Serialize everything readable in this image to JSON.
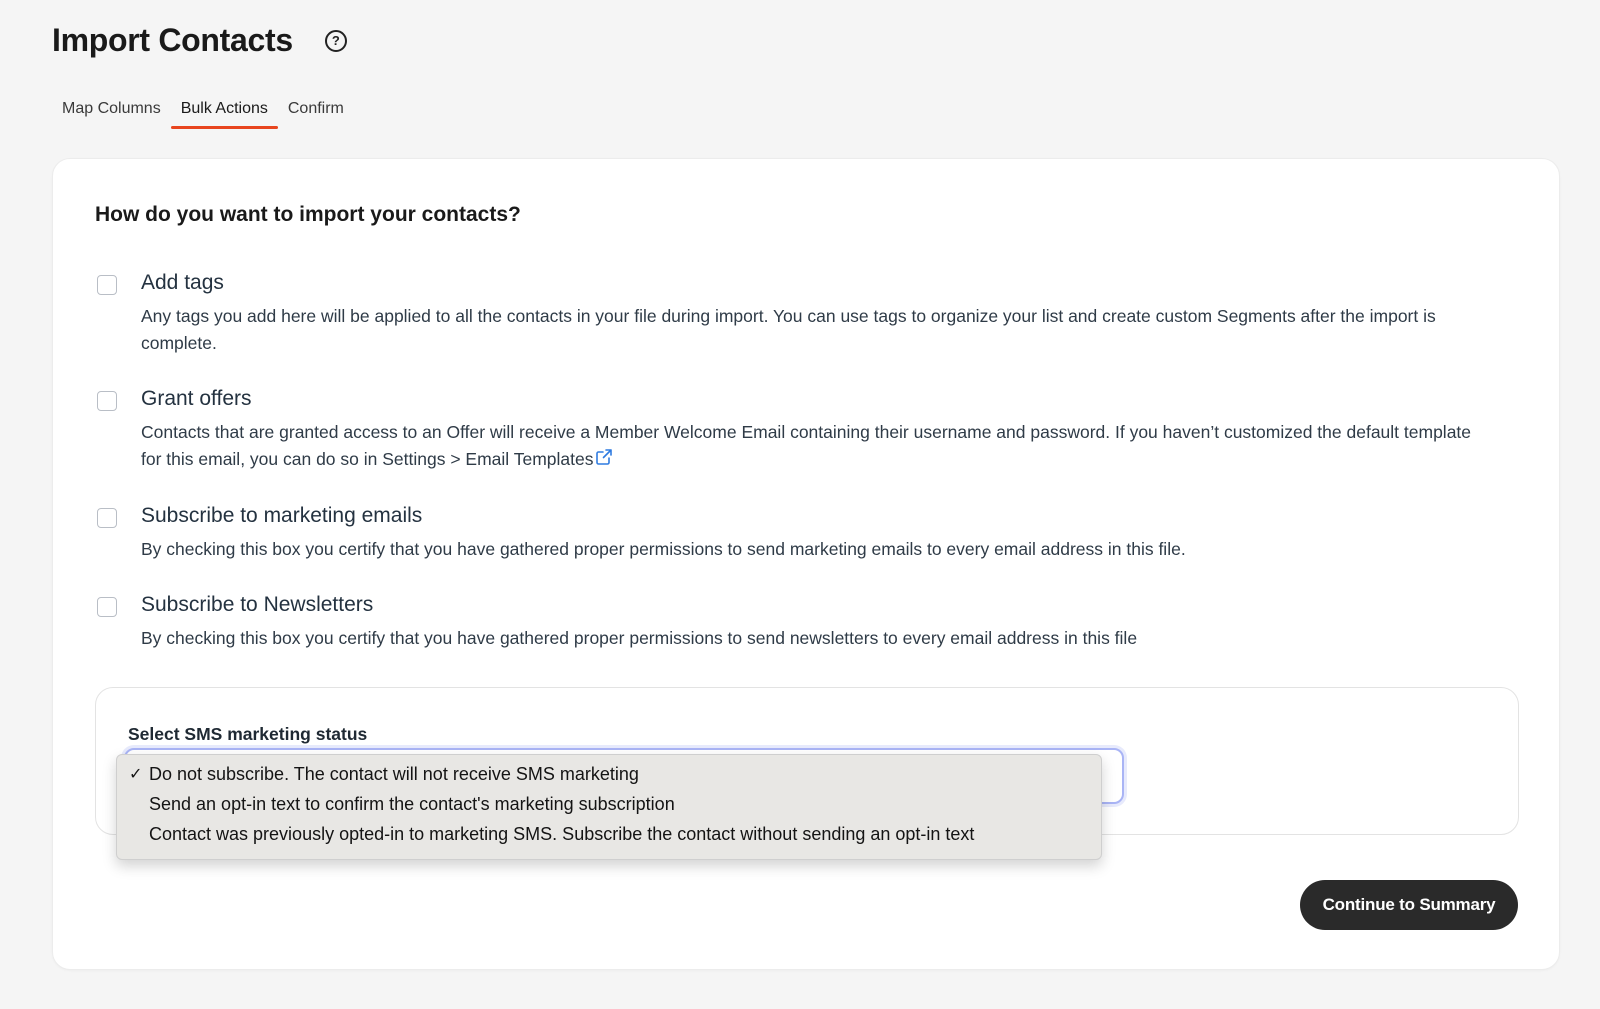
{
  "header": {
    "title": "Import Contacts",
    "help_icon": "question-circle-icon"
  },
  "tabs": [
    {
      "label": "Map Columns",
      "active": false
    },
    {
      "label": "Bulk Actions",
      "active": true
    },
    {
      "label": "Confirm",
      "active": false
    }
  ],
  "card": {
    "heading": "How do you want to import your contacts?",
    "options": [
      {
        "title": "Add tags",
        "description": "Any tags you add here will be applied to all the contacts in your file during import. You can use tags to organize your list and create custom Segments after the import is complete.",
        "checked": false
      },
      {
        "title": "Grant offers",
        "description": "Contacts that are granted access to an Offer will receive a Member Welcome Email containing their username and password. If you haven’t customized the default template for this email, you can do so in Settings > Email Templates",
        "checked": false,
        "link_icon": "external-link-icon"
      },
      {
        "title": "Subscribe to marketing emails",
        "description": "By checking this box you certify that you have gathered proper permissions to send marketing emails to every email address in this file.",
        "checked": false
      },
      {
        "title": "Subscribe to Newsletters",
        "description": "By checking this box you certify that you have gathered proper permissions to send newsletters to every email address in this file",
        "checked": false
      }
    ],
    "sms": {
      "label": "Select SMS marketing status",
      "options": [
        {
          "label": "Do not subscribe. The contact will not receive SMS marketing",
          "selected": true
        },
        {
          "label": "Send an opt-in text to confirm the contact's marketing subscription",
          "selected": false
        },
        {
          "label": "Contact was previously opted-in to marketing SMS. Subscribe the contact without sending an opt-in text",
          "selected": false
        }
      ],
      "check_mark": "✓"
    },
    "continue_label": "Continue to Summary"
  },
  "colors": {
    "accent": "#e8451e",
    "button_bg": "#2a2a2a",
    "focus_ring": "#a9b4f5",
    "link_icon": "#2f7be0"
  }
}
